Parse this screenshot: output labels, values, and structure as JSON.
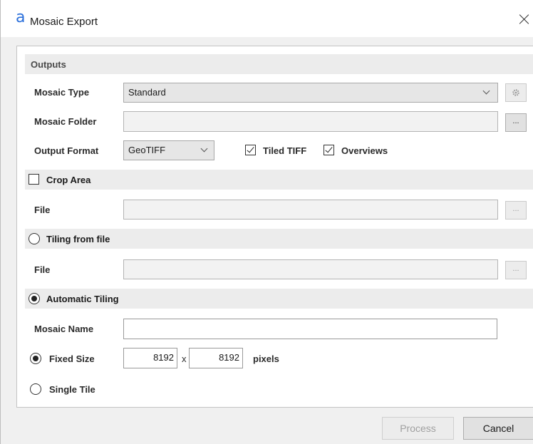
{
  "window": {
    "title": "Mosaic Export",
    "logo_glyph": "a"
  },
  "outputs": {
    "header": "Outputs",
    "mosaic_type": {
      "label": "Mosaic Type",
      "value": "Standard"
    },
    "mosaic_folder": {
      "label": "Mosaic Folder",
      "value": "",
      "browse": "..."
    },
    "output_format": {
      "label": "Output Format",
      "value": "GeoTIFF"
    },
    "tiled_tiff": {
      "label": "Tiled TIFF",
      "checked": true
    },
    "overviews": {
      "label": "Overviews",
      "checked": true
    }
  },
  "crop_area": {
    "header": "Crop Area",
    "checked": false,
    "file_label": "File",
    "file_value": "",
    "browse": "..."
  },
  "tiling_from_file": {
    "header": "Tiling from file",
    "selected": false,
    "file_label": "File",
    "file_value": "",
    "browse": "..."
  },
  "automatic_tiling": {
    "header": "Automatic Tiling",
    "selected": true,
    "mosaic_name": {
      "label": "Mosaic Name",
      "value": ""
    },
    "fixed_size": {
      "label": "Fixed Size",
      "selected": true,
      "width": "8192",
      "separator": "x",
      "height": "8192",
      "unit": "pixels"
    },
    "single_tile": {
      "label": "Single Tile",
      "selected": false
    }
  },
  "footer": {
    "process_label": "Process",
    "cancel_label": "Cancel"
  },
  "icons": {
    "settings": "gear-icon",
    "close": "close-icon"
  }
}
